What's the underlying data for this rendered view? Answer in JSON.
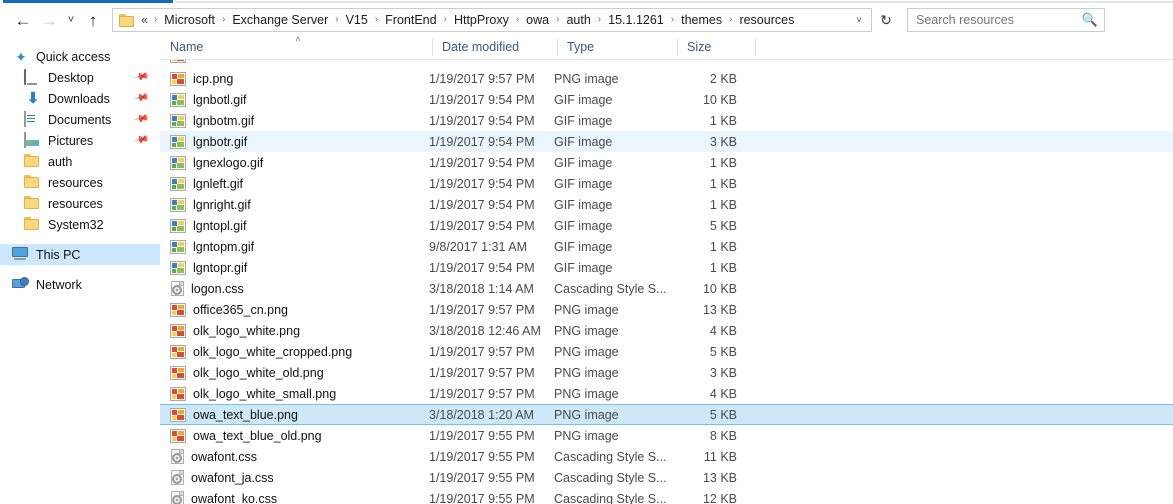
{
  "window": {
    "ribbon_active_tab": "",
    "nav": {
      "back_icon": "arrow-left-icon",
      "back_label": "←",
      "forward_label": "→",
      "recent_label": "˅",
      "up_label": "↑",
      "refresh_label": "↻",
      "address_dropdown_label": "˅"
    }
  },
  "address": {
    "leading_ellipsis": "«",
    "separator": "›",
    "crumbs": [
      "Microsoft",
      "Exchange Server",
      "V15",
      "FrontEnd",
      "HttpProxy",
      "owa",
      "auth",
      "15.1.1261",
      "themes",
      "resources"
    ]
  },
  "search": {
    "placeholder": "Search resources",
    "icon": "search-icon"
  },
  "sidebar": {
    "items": [
      {
        "label": "Quick access",
        "icon": "star-icon",
        "indent": "root",
        "pinned": false,
        "selected": false
      },
      {
        "label": "Desktop",
        "icon": "monitor-icon",
        "indent": "1",
        "pinned": true,
        "selected": false
      },
      {
        "label": "Downloads",
        "icon": "download-icon",
        "indent": "1",
        "pinned": true,
        "selected": false
      },
      {
        "label": "Documents",
        "icon": "document-icon",
        "indent": "1",
        "pinned": true,
        "selected": false
      },
      {
        "label": "Pictures",
        "icon": "pictures-icon",
        "indent": "1",
        "pinned": true,
        "selected": false
      },
      {
        "label": "auth",
        "icon": "folder-icon",
        "indent": "1",
        "pinned": false,
        "selected": false
      },
      {
        "label": "resources",
        "icon": "folder-icon",
        "indent": "1",
        "pinned": false,
        "selected": false
      },
      {
        "label": "resources",
        "icon": "folder-icon",
        "indent": "1",
        "pinned": false,
        "selected": false
      },
      {
        "label": "System32",
        "icon": "folder-icon",
        "indent": "1",
        "pinned": false,
        "selected": false
      },
      {
        "label": "This PC",
        "icon": "this-pc-icon",
        "indent": "root",
        "pinned": false,
        "selected": true
      },
      {
        "label": "Network",
        "icon": "network-icon",
        "indent": "root",
        "pinned": false,
        "selected": false
      }
    ]
  },
  "filelist": {
    "columns": [
      {
        "label": "Name",
        "sorted": true,
        "sort_caret": "˄"
      },
      {
        "label": "Date modified",
        "sorted": false,
        "sort_caret": ""
      },
      {
        "label": "Type",
        "sorted": false,
        "sort_caret": ""
      },
      {
        "label": "Size",
        "sorted": false,
        "sort_caret": ""
      }
    ],
    "clipped_top_row": {
      "name": "",
      "date": "",
      "type": "",
      "size": "",
      "icon": "png-file-icon"
    },
    "rows": [
      {
        "name": "icp.png",
        "date": "1/19/2017 9:57 PM",
        "type": "PNG image",
        "size": "2 KB",
        "icon": "png-file-icon",
        "state": ""
      },
      {
        "name": "lgnbotl.gif",
        "date": "1/19/2017 9:54 PM",
        "type": "GIF image",
        "size": "10 KB",
        "icon": "gif-file-icon",
        "state": ""
      },
      {
        "name": "lgnbotm.gif",
        "date": "1/19/2017 9:54 PM",
        "type": "GIF image",
        "size": "1 KB",
        "icon": "gif-file-icon",
        "state": ""
      },
      {
        "name": "lgnbotr.gif",
        "date": "1/19/2017 9:54 PM",
        "type": "GIF image",
        "size": "3 KB",
        "icon": "gif-file-icon",
        "state": "hover"
      },
      {
        "name": "lgnexlogo.gif",
        "date": "1/19/2017 9:54 PM",
        "type": "GIF image",
        "size": "1 KB",
        "icon": "gif-file-icon",
        "state": ""
      },
      {
        "name": "lgnleft.gif",
        "date": "1/19/2017 9:54 PM",
        "type": "GIF image",
        "size": "1 KB",
        "icon": "gif-file-icon",
        "state": ""
      },
      {
        "name": "lgnright.gif",
        "date": "1/19/2017 9:54 PM",
        "type": "GIF image",
        "size": "1 KB",
        "icon": "gif-file-icon",
        "state": ""
      },
      {
        "name": "lgntopl.gif",
        "date": "1/19/2017 9:54 PM",
        "type": "GIF image",
        "size": "5 KB",
        "icon": "gif-file-icon",
        "state": ""
      },
      {
        "name": "lgntopm.gif",
        "date": "9/8/2017 1:31 AM",
        "type": "GIF image",
        "size": "1 KB",
        "icon": "gif-file-icon",
        "state": ""
      },
      {
        "name": "lgntopr.gif",
        "date": "1/19/2017 9:54 PM",
        "type": "GIF image",
        "size": "1 KB",
        "icon": "gif-file-icon",
        "state": ""
      },
      {
        "name": "logon.css",
        "date": "3/18/2018 1:14 AM",
        "type": "Cascading Style S...",
        "size": "10 KB",
        "icon": "css-file-icon",
        "state": ""
      },
      {
        "name": "office365_cn.png",
        "date": "1/19/2017 9:57 PM",
        "type": "PNG image",
        "size": "13 KB",
        "icon": "png-file-icon",
        "state": ""
      },
      {
        "name": "olk_logo_white.png",
        "date": "3/18/2018 12:46 AM",
        "type": "PNG image",
        "size": "4 KB",
        "icon": "png-file-icon",
        "state": ""
      },
      {
        "name": "olk_logo_white_cropped.png",
        "date": "1/19/2017 9:57 PM",
        "type": "PNG image",
        "size": "5 KB",
        "icon": "png-file-icon",
        "state": ""
      },
      {
        "name": "olk_logo_white_old.png",
        "date": "1/19/2017 9:57 PM",
        "type": "PNG image",
        "size": "3 KB",
        "icon": "png-file-icon",
        "state": ""
      },
      {
        "name": "olk_logo_white_small.png",
        "date": "1/19/2017 9:57 PM",
        "type": "PNG image",
        "size": "4 KB",
        "icon": "png-file-icon",
        "state": ""
      },
      {
        "name": "owa_text_blue.png",
        "date": "3/18/2018 1:20 AM",
        "type": "PNG image",
        "size": "5 KB",
        "icon": "png-file-icon",
        "state": "selected"
      },
      {
        "name": "owa_text_blue_old.png",
        "date": "1/19/2017 9:55 PM",
        "type": "PNG image",
        "size": "8 KB",
        "icon": "png-file-icon",
        "state": ""
      },
      {
        "name": "owafont.css",
        "date": "1/19/2017 9:55 PM",
        "type": "Cascading Style S...",
        "size": "11 KB",
        "icon": "css-file-icon",
        "state": ""
      },
      {
        "name": "owafont_ja.css",
        "date": "1/19/2017 9:55 PM",
        "type": "Cascading Style S...",
        "size": "13 KB",
        "icon": "css-file-icon",
        "state": ""
      },
      {
        "name": "owafont_ko.css",
        "date": "1/19/2017 9:55 PM",
        "type": "Cascading Style S...",
        "size": "12 KB",
        "icon": "css-file-icon",
        "state": ""
      }
    ]
  },
  "colors": {
    "selection_fill": "#cde8f9",
    "selection_border": "#7cc0e8",
    "hover_fill": "#eaf6fd",
    "header_text": "#3b5b7d",
    "accent": "#0f6cbd"
  }
}
